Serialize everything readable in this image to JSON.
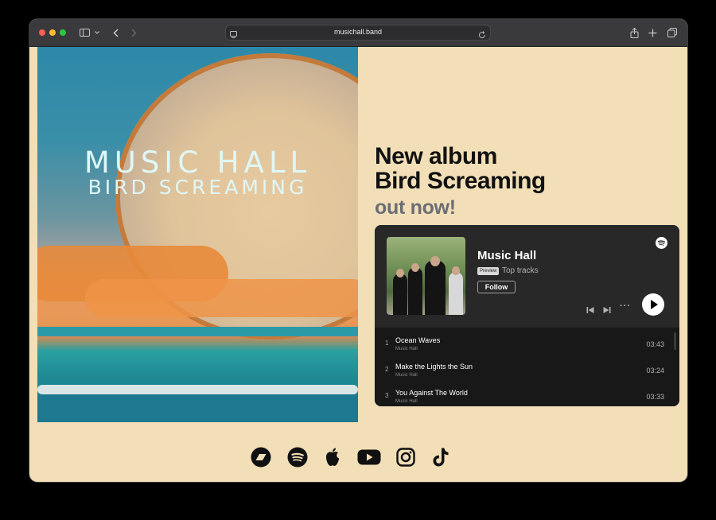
{
  "browser": {
    "url": "musichall.band",
    "icons": [
      "sidebar-icon",
      "chevron-down-icon",
      "back-icon",
      "forward-icon",
      "reader-icon",
      "reload-icon",
      "share-icon",
      "new-tab-icon",
      "tabs-overview-icon"
    ]
  },
  "cover": {
    "title": "MUSIC HALL",
    "subtitle": "BIRD SCREAMING"
  },
  "headline": {
    "line1": "New album",
    "line2": "Bird Screaming",
    "line3": "out now!"
  },
  "player": {
    "artist": "Music Hall",
    "badge": "Preview",
    "subtitle": "Top tracks",
    "follow_label": "Follow",
    "more_label": "···",
    "tracks": [
      {
        "num": "1",
        "title": "Ocean Waves",
        "artist": "Music Hall",
        "duration": "03:43"
      },
      {
        "num": "2",
        "title": "Make the Lights the Sun",
        "artist": "Music Hall",
        "duration": "03:24"
      },
      {
        "num": "3",
        "title": "You Against The World",
        "artist": "Music Hall",
        "duration": "03:33"
      }
    ]
  },
  "socials": [
    "bandcamp-icon",
    "spotify-icon",
    "apple-icon",
    "youtube-icon",
    "instagram-icon",
    "tiktok-icon"
  ],
  "colors": {
    "page_bg": "#f2dfb7",
    "player_bg": "#282828",
    "tracklist_bg": "#181818",
    "accent_gray": "#6b6d73"
  }
}
